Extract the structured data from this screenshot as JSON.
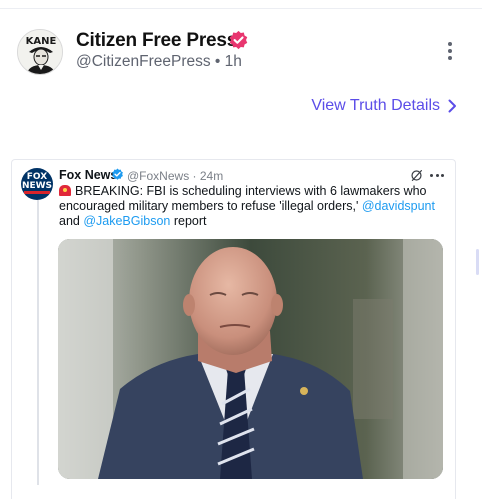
{
  "post": {
    "author_name": "Citizen Free Press",
    "handle_line": "@CitizenFreePress • 1h",
    "avatar_text": "KANE",
    "view_details_label": "View Truth Details"
  },
  "tweet": {
    "author_name": "Fox News",
    "handle_time": "@FoxNews · 24m",
    "text_main": "BREAKING: FBI is scheduling interviews with 6 lawmakers who encouraged military members to refuse 'illegal orders,' ",
    "mention_1": "@davidspunt",
    "text_and": " and ",
    "mention_2": "@JakeBGibson",
    "text_end": " report",
    "logo_line_1": "FOX",
    "logo_line_2": "NEWS"
  },
  "colors": {
    "accent_link": "#5b4de8",
    "verified_badge_post": "#e8366f",
    "verified_badge_tweet": "#1d9bf0",
    "mention": "#1d9bf0"
  },
  "icons": {
    "post_more": "vertical-ellipsis-icon",
    "view_details": "chevron-right-icon",
    "tweet_more": "horizontal-ellipsis-icon",
    "tweet_grok": "grok-icon",
    "breaking": "siren-emoji-icon"
  }
}
